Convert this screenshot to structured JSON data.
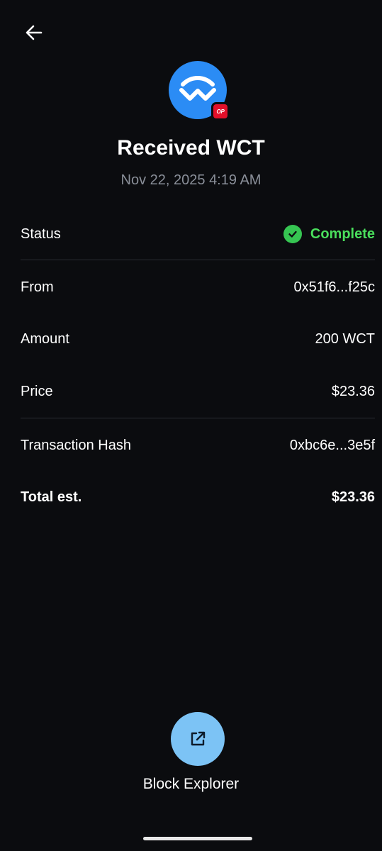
{
  "header": {
    "back_icon": "arrow-left-icon",
    "title": "Received WCT",
    "date": "Nov 22, 2025 4:19 AM"
  },
  "token": {
    "logo_icon": "walletconnect-logo-icon",
    "logo_color": "#2b8cf5",
    "network_badge": "OP",
    "network_color": "#e2102a"
  },
  "details": {
    "status": {
      "label": "Status",
      "value": "Complete",
      "icon": "check-circle-icon",
      "color": "#4ade5c"
    },
    "from": {
      "label": "From",
      "value": "0x51f6...f25c"
    },
    "amount": {
      "label": "Amount",
      "value": "200 WCT"
    },
    "price": {
      "label": "Price",
      "value": "$23.36"
    },
    "tx_hash": {
      "label": "Transaction Hash",
      "value": "0xbc6e...3e5f"
    },
    "total": {
      "label": "Total est.",
      "value": "$23.36"
    }
  },
  "actions": {
    "block_explorer": {
      "label": "Block Explorer",
      "icon": "external-link-icon",
      "color": "#7cc3f5"
    }
  }
}
